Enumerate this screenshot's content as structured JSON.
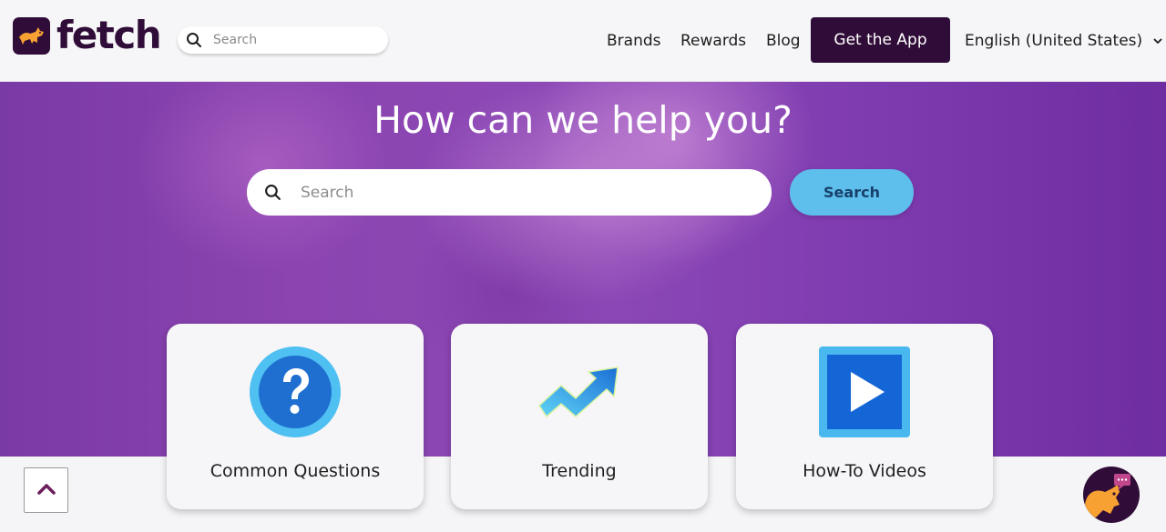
{
  "header": {
    "logo_text": "fetch",
    "logo_icon": "dog-icon",
    "search": {
      "placeholder": "Search",
      "icon": "search-icon"
    },
    "nav": [
      {
        "label": "Brands"
      },
      {
        "label": "Rewards"
      },
      {
        "label": "Blog"
      }
    ],
    "cta_label": "Get the App",
    "language": {
      "label": "English (United States)",
      "icon": "chevron-down-icon"
    }
  },
  "hero": {
    "title": "How can we help you?",
    "search_placeholder": "Search",
    "search_button": "Search"
  },
  "cards": [
    {
      "label": "Common Questions",
      "icon": "question-mark-icon"
    },
    {
      "label": "Trending",
      "icon": "trending-arrow-icon"
    },
    {
      "label": "How-To Videos",
      "icon": "play-video-icon"
    }
  ],
  "widgets": {
    "scroll_top_icon": "chevron-up-icon",
    "chat_icon": "dog-chat-icon"
  },
  "colors": {
    "brand_dark": "#300d38",
    "hero_purple": "#8b44b0",
    "search_button": "#5ebeec",
    "logo_orange": "#f7a133"
  }
}
